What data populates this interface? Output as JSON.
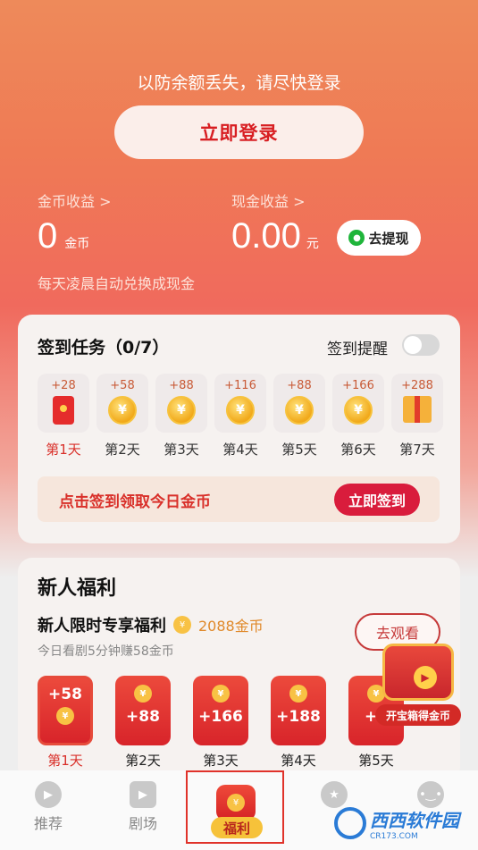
{
  "header": {
    "notice": "以防余额丢失，请尽快登录",
    "login_button": "立即登录",
    "coin_earnings_label": "金币收益 >",
    "coin_value": "0",
    "coin_unit": "金币",
    "cash_earnings_label": "现金收益 >",
    "cash_value": "0.00",
    "cash_unit": "元",
    "withdraw_button": "去提现",
    "auto_exchange_text": "每天凌晨自动兑换成现金"
  },
  "checkin": {
    "title": "签到任务（0/7）",
    "reminder_label": "签到提醒",
    "reminder_on": false,
    "days": [
      {
        "points": "+28",
        "label": "第1天",
        "icon": "red-envelope-icon"
      },
      {
        "points": "+58",
        "label": "第2天",
        "icon": "coin-icon"
      },
      {
        "points": "+88",
        "label": "第3天",
        "icon": "coin-icon"
      },
      {
        "points": "+116",
        "label": "第4天",
        "icon": "coin-icon"
      },
      {
        "points": "+88",
        "label": "第5天",
        "icon": "coin-icon"
      },
      {
        "points": "+166",
        "label": "第6天",
        "icon": "coin-icon"
      },
      {
        "points": "+288",
        "label": "第7天",
        "icon": "gift-icon"
      }
    ],
    "prompt_text": "点击签到领取今日金币",
    "sign_button": "立即签到",
    "coin_symbol": "¥"
  },
  "newbie": {
    "title": "新人福利",
    "subtitle": "新人限时专享福利",
    "total_coins": "2088金币",
    "description": "今日看剧5分钟赚58金币",
    "watch_button": "去观看",
    "envelopes": [
      {
        "value": "+58",
        "label": "第1天"
      },
      {
        "value": "+88",
        "label": "第2天"
      },
      {
        "value": "+166",
        "label": "第3天"
      },
      {
        "value": "+188",
        "label": "第4天"
      },
      {
        "value": "+1",
        "label": "第5天"
      }
    ],
    "treasure_label": "开宝箱得金币"
  },
  "tabbar": {
    "tabs": [
      {
        "label": "推荐",
        "icon": "play-icon"
      },
      {
        "label": "剧场",
        "icon": "tv-icon"
      },
      {
        "label": "福利",
        "icon": "red-bag-icon"
      },
      {
        "label": "",
        "icon": "star-icon"
      },
      {
        "label": "",
        "icon": "face-icon"
      }
    ]
  },
  "watermark": {
    "text": "西西软件园",
    "sub": "CR173.COM"
  },
  "colors": {
    "brand_red": "#d91c3c",
    "header_top": "#ee8a5a",
    "coin_gold": "#f1a91a"
  }
}
